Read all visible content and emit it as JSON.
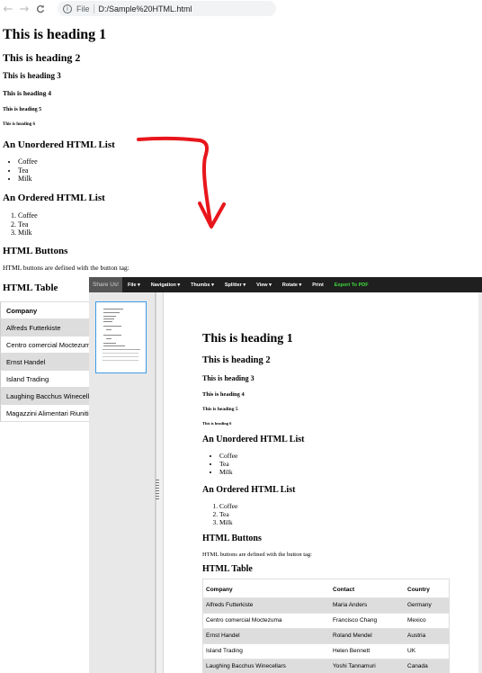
{
  "browser": {
    "scheme": "File",
    "url": "D:/Sample%20HTML.html",
    "back_glyph": "←",
    "forward_glyph": "→",
    "reload_glyph": "C",
    "info_glyph": "i"
  },
  "raw_page": {
    "h1": "This is heading 1",
    "h2": "This is heading 2",
    "h3": "This is heading 3",
    "h4": "This is heading 4",
    "h5": "This is heading 5",
    "h6": "This is heading 6",
    "ul_title": "An Unordered HTML List",
    "ul_items": [
      "Coffee",
      "Tea",
      "Milk"
    ],
    "ol_title": "An Ordered HTML List",
    "ol_items": [
      "Coffee",
      "Tea",
      "Milk"
    ],
    "buttons_title": "HTML Buttons",
    "buttons_text": "HTML buttons are defined with the button tag:",
    "table_title": "HTML Table",
    "table": {
      "header": "Company",
      "rows": [
        "Alfreds Futterkiste",
        "Centro comercial Moctezuma",
        "Ernst Handel",
        "Island Trading",
        "Laughing Bacchus Winecellars",
        "Magazzini Alimentari Riuniti"
      ]
    }
  },
  "viewer": {
    "toolbar": {
      "share": "Share Us!",
      "menus": [
        "File ▾",
        "Navigation ▾",
        "Thumbs ▾",
        "Splitter ▾",
        "View ▾",
        "Rotate ▾",
        "Print"
      ],
      "export": "Export To PDF"
    },
    "document": {
      "h1": "This is heading 1",
      "h2": "This is heading 2",
      "h3": "This is heading 3",
      "h4": "This is heading 4",
      "h5": "This is heading 5",
      "h6": "This is heading 6",
      "ul_title": "An Unordered HTML List",
      "ul_items": [
        "Coffee",
        "Tea",
        "Milk"
      ],
      "ol_title": "An Ordered HTML List",
      "ol_items": [
        "Coffee",
        "Tea",
        "Milk"
      ],
      "buttons_title": "HTML Buttons",
      "buttons_text": "HTML buttons are defined with the button tag:",
      "table_title": "HTML Table",
      "table": {
        "headers": [
          "Company",
          "Contact",
          "Country"
        ],
        "rows": [
          [
            "Alfreds Futterkiste",
            "Maria Anders",
            "Germany"
          ],
          [
            "Centro comercial Moctezuma",
            "Francisco Chang",
            "Mexico"
          ],
          [
            "Ernst Handel",
            "Roland Mendel",
            "Austria"
          ],
          [
            "Island Trading",
            "Helen Bennett",
            "UK"
          ],
          [
            "Laughing Bacchus Winecellars",
            "Yoshi Tannamuri",
            "Canada"
          ]
        ]
      }
    }
  },
  "colors": {
    "arrow": "#e8161b",
    "toolbar_bg": "#1f1f1f",
    "export": "#3ddc3d",
    "thumb_border": "#3c9be8"
  }
}
